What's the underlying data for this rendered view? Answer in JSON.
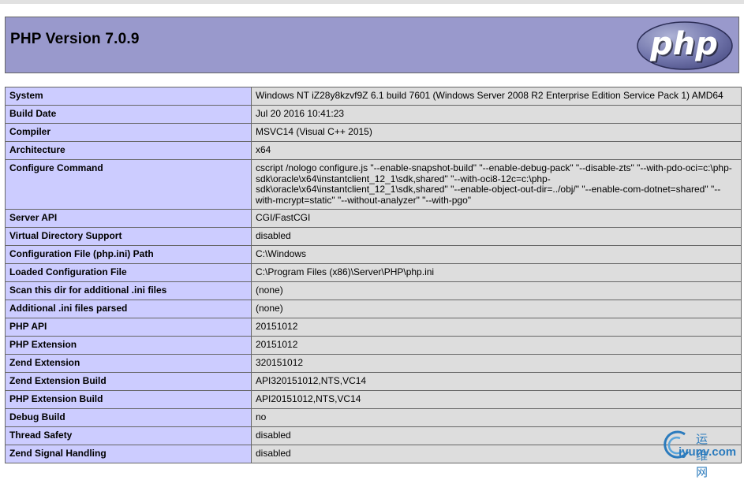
{
  "header": {
    "title": "PHP Version 7.0.9",
    "logo_text": "php"
  },
  "rows": [
    {
      "label": "System",
      "value": "Windows NT iZ28y8kzvf9Z 6.1 build 7601 (Windows Server 2008 R2 Enterprise Edition Service Pack 1) AMD64"
    },
    {
      "label": "Build Date",
      "value": "Jul 20 2016 10:41:23"
    },
    {
      "label": "Compiler",
      "value": "MSVC14 (Visual C++ 2015)"
    },
    {
      "label": "Architecture",
      "value": "x64"
    },
    {
      "label": "Configure Command",
      "value": "cscript /nologo configure.js \"--enable-snapshot-build\" \"--enable-debug-pack\" \"--disable-zts\" \"--with-pdo-oci=c:\\php-sdk\\oracle\\x64\\instantclient_12_1\\sdk,shared\" \"--with-oci8-12c=c:\\php-sdk\\oracle\\x64\\instantclient_12_1\\sdk,shared\" \"--enable-object-out-dir=../obj/\" \"--enable-com-dotnet=shared\" \"--with-mcrypt=static\" \"--without-analyzer\" \"--with-pgo\""
    },
    {
      "label": "Server API",
      "value": "CGI/FastCGI"
    },
    {
      "label": "Virtual Directory Support",
      "value": "disabled"
    },
    {
      "label": "Configuration File (php.ini) Path",
      "value": "C:\\Windows"
    },
    {
      "label": "Loaded Configuration File",
      "value": "C:\\Program Files (x86)\\Server\\PHP\\php.ini"
    },
    {
      "label": "Scan this dir for additional .ini files",
      "value": "(none)"
    },
    {
      "label": "Additional .ini files parsed",
      "value": "(none)"
    },
    {
      "label": "PHP API",
      "value": "20151012"
    },
    {
      "label": "PHP Extension",
      "value": "20151012"
    },
    {
      "label": "Zend Extension",
      "value": "320151012"
    },
    {
      "label": "Zend Extension Build",
      "value": "API320151012,NTS,VC14"
    },
    {
      "label": "PHP Extension Build",
      "value": "API20151012,NTS,VC14"
    },
    {
      "label": "Debug Build",
      "value": "no"
    },
    {
      "label": "Thread Safety",
      "value": "disabled"
    },
    {
      "label": "Zend Signal Handling",
      "value": "disabled"
    }
  ],
  "watermark": {
    "cn": "运维网",
    "en": "iyunv.com"
  }
}
